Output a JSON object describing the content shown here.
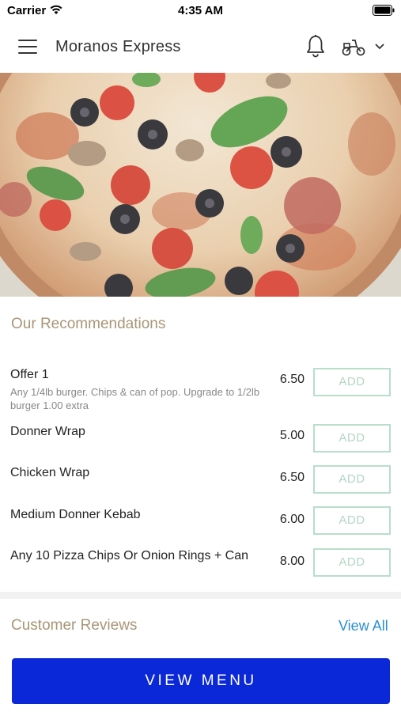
{
  "status_bar": {
    "carrier": "Carrier",
    "time": "4:35 AM"
  },
  "header": {
    "title": "Moranos Express",
    "icons": [
      "menu-icon",
      "bell-icon",
      "scooter-icon",
      "chevron-down-icon"
    ]
  },
  "hero": {
    "image": "pizza-photo"
  },
  "recommendations": {
    "title": "Our Recommendations",
    "add_label": "ADD",
    "items": [
      {
        "name": "Offer 1",
        "description": "Any 1/4lb burger. Chips & can of pop. Upgrade to 1/2lb burger 1.00 extra",
        "price": "6.50"
      },
      {
        "name": "Donner Wrap",
        "description": "",
        "price": "5.00"
      },
      {
        "name": "Chicken Wrap",
        "description": "",
        "price": "6.50"
      },
      {
        "name": "Medium Donner Kebab",
        "description": "",
        "price": "6.00"
      },
      {
        "name": "Any 10 Pizza Chips Or Onion Rings + Can",
        "description": "",
        "price": "8.00"
      }
    ]
  },
  "reviews": {
    "title": "Customer Reviews",
    "view_all": "View All"
  },
  "footer": {
    "view_menu": "VIEW MENU"
  },
  "colors": {
    "accent_gold": "#a89676",
    "add_border": "#b9dec9",
    "link_blue": "#2b8fd0",
    "button_blue": "#0b28d8"
  }
}
